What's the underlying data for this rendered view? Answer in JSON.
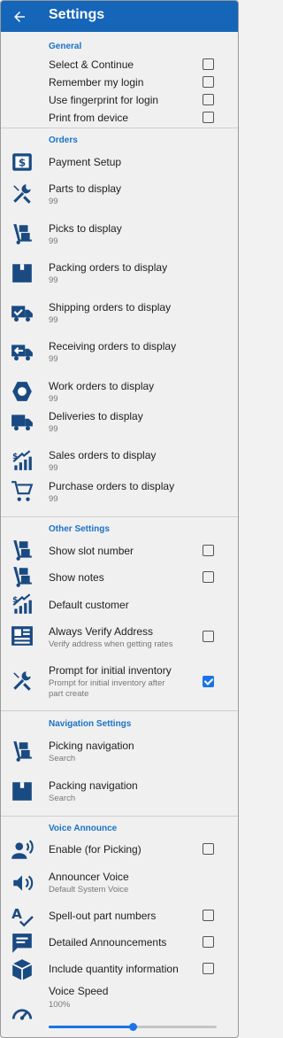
{
  "header": {
    "title": "Settings"
  },
  "general": {
    "header": "General",
    "items": [
      {
        "label": "Select & Continue",
        "checked": false
      },
      {
        "label": "Remember my login",
        "checked": false
      },
      {
        "label": "Use fingerprint for login",
        "checked": false
      },
      {
        "label": "Print from device",
        "checked": false
      }
    ]
  },
  "orders": {
    "header": "Orders",
    "payment_setup": "Payment Setup",
    "items": [
      {
        "label": "Parts to display",
        "value": "99",
        "icon": "tools-icon"
      },
      {
        "label": "Picks to display",
        "value": "99",
        "icon": "hand-truck-icon"
      },
      {
        "label": "Packing orders to display",
        "value": "99",
        "icon": "box-icon"
      },
      {
        "label": "Shipping orders to display",
        "value": "99",
        "icon": "truck-check-icon"
      },
      {
        "label": "Receiving orders to display",
        "value": "99",
        "icon": "truck-receive-icon"
      },
      {
        "label": "Work orders to display",
        "value": "99",
        "icon": "hex-nut-icon"
      },
      {
        "label": "Deliveries to display",
        "value": "99",
        "icon": "delivery-truck-icon"
      },
      {
        "label": "Sales orders to display",
        "value": "99",
        "icon": "sales-chart-icon"
      },
      {
        "label": "Purchase orders to display",
        "value": "99",
        "icon": "cart-icon"
      }
    ]
  },
  "other": {
    "header": "Other Settings",
    "show_slot": {
      "label": "Show slot number",
      "checked": false
    },
    "show_notes": {
      "label": "Show notes",
      "checked": false
    },
    "default_customer": {
      "label": "Default customer"
    },
    "verify_address": {
      "label": "Always Verify Address",
      "sub": "Verify address when getting rates",
      "checked": false
    },
    "initial_inventory": {
      "label": "Prompt for initial inventory",
      "sub1": "Prompt for initial inventory after",
      "sub2": "part create",
      "checked": true
    }
  },
  "navigation": {
    "header": "Navigation Settings",
    "picking": {
      "label": "Picking navigation",
      "value": "Search"
    },
    "packing": {
      "label": "Packing navigation",
      "value": "Search"
    }
  },
  "voice": {
    "header": "Voice Announce",
    "enable": {
      "label": "Enable (for Picking)",
      "checked": false
    },
    "announcer": {
      "label": "Announcer Voice",
      "value": "Default System Voice"
    },
    "spell_out": {
      "label": "Spell-out part numbers",
      "checked": false
    },
    "detailed": {
      "label": "Detailed Announcements",
      "checked": false
    },
    "quantity": {
      "label": "Include quantity information",
      "checked": false
    },
    "speed": {
      "label": "Voice Speed",
      "value": "100%",
      "fraction": 0.5
    }
  },
  "colors": {
    "primary": "#1565b8",
    "accent": "#1a73e8",
    "icon": "#1a4a82"
  }
}
